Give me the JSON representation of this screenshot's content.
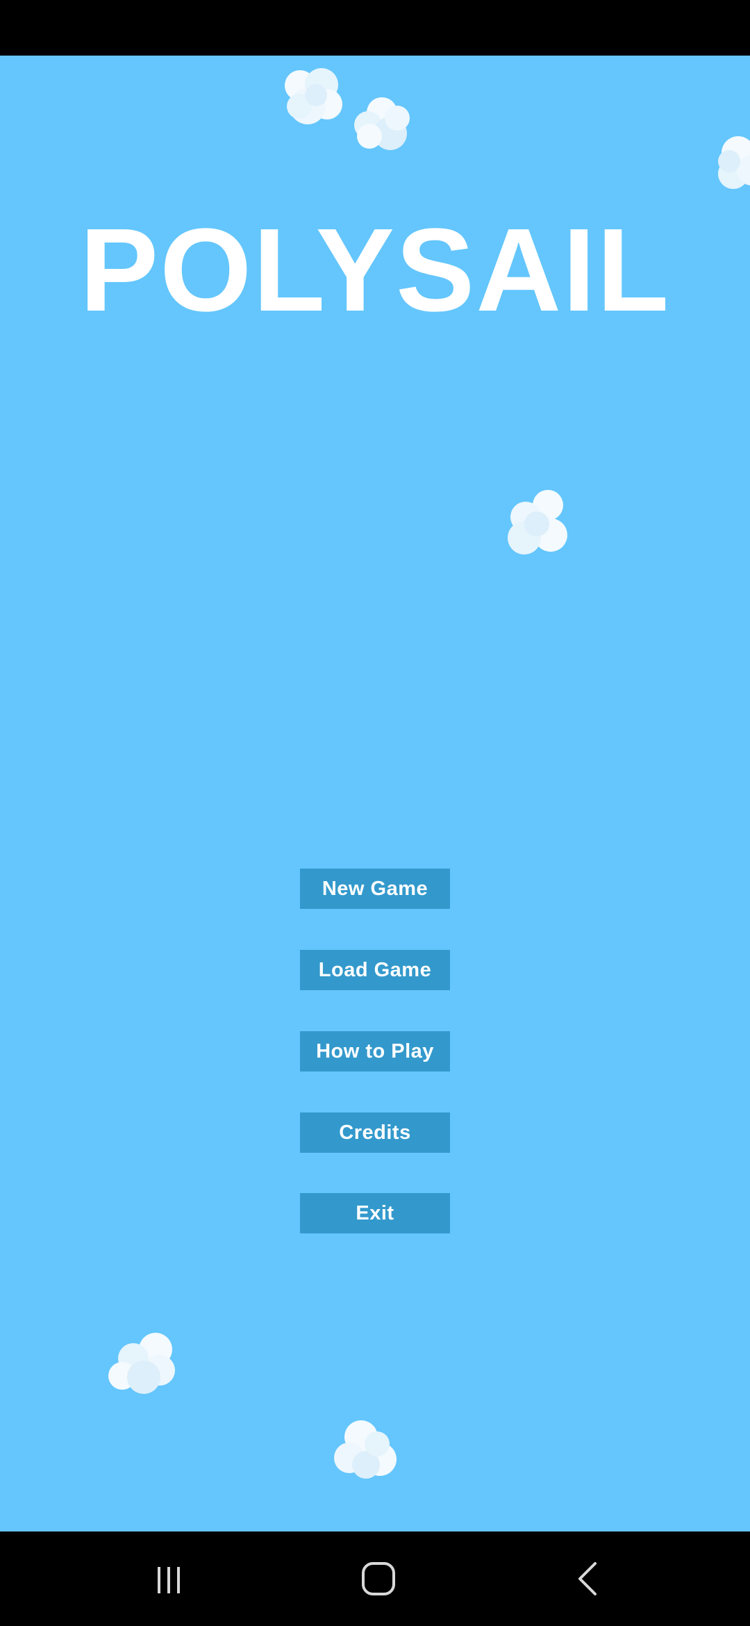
{
  "game": {
    "title": "POLYSAIL",
    "background_color": "#64C6FC",
    "button_color": "#3399CC",
    "menu": {
      "new_game": "New Game",
      "load_game": "Load Game",
      "how_to_play": "How to Play",
      "credits": "Credits",
      "exit": "Exit"
    }
  },
  "navigation_bar": {
    "recents_icon": "recent-apps-icon",
    "home_icon": "home-icon",
    "back_icon": "back-icon"
  }
}
